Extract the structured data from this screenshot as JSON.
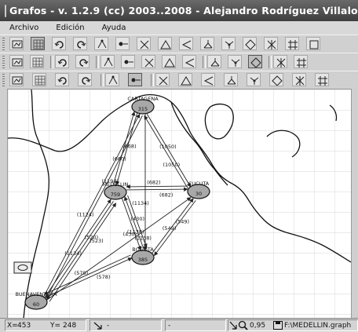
{
  "window": {
    "title": "Grafos - v. 1.2.9  (cc) 2003..2008 - Alejandro Rodríguez Villalobos"
  },
  "menu": [
    "Archivo",
    "Edición",
    "Ayuda"
  ],
  "toolbars": {
    "row1": [
      "new-graph-icon",
      "grid-icon",
      "undo-icon",
      "redo-icon",
      "bend-icon",
      "draw-node-icon",
      "edit-node-icon",
      "triangle-icon",
      "arrow-icon",
      "tree-icon",
      "tree-alt-icon",
      "network-icon",
      "network-alt-icon",
      "network-flow-icon",
      "frame-icon"
    ],
    "row2": [
      "open-icon",
      "save-icon",
      "matrix-icon",
      "matrix-alt-icon",
      "table-icon",
      "table-alt-icon",
      "table-grid-icon",
      "list-icon",
      "list-alt-icon",
      "connect-icon",
      "connect-alt-icon",
      "connect-active-icon",
      "path-icon",
      "path-alt-icon"
    ],
    "row3": [
      "shape-tool-icon",
      "tree-tool-icon",
      "route-tool-icon",
      "gear-tool-icon",
      "select-icon",
      "move-icon",
      "edge-tool-icon",
      "arc-tool-icon",
      "loop-tool-icon",
      "polygon-tool-icon",
      "curve-tool-icon",
      "hexagon-tool-icon",
      "cube-tool-icon",
      "pattern-tool-icon"
    ]
  },
  "graph": {
    "nodes": [
      {
        "id": "cartagena",
        "label": "CARTAGENA",
        "value": "315"
      },
      {
        "id": "medellin",
        "label": "MEDELLIN",
        "value": "759"
      },
      {
        "id": "cucuta",
        "label": "CUCUTA",
        "value": "30"
      },
      {
        "id": "bogota",
        "label": "BOGOTA",
        "value": "385"
      },
      {
        "id": "buenaventura",
        "label": "BUENAVENTURA",
        "value": "60"
      }
    ],
    "edges": [
      {
        "from": "cartagena",
        "to": "medellin",
        "label": "(660)"
      },
      {
        "from": "medellin",
        "to": "cartagena",
        "label": "(668)"
      },
      {
        "from": "cartagena",
        "to": "cucuta",
        "label": "(1050)"
      },
      {
        "from": "cucuta",
        "to": "cartagena",
        "label": "(1050)"
      },
      {
        "from": "cartagena",
        "to": "bogota",
        "label": "(1134)"
      },
      {
        "from": "medellin",
        "to": "cucuta",
        "label": "(682)"
      },
      {
        "from": "cucuta",
        "to": "medellin",
        "label": "(682)"
      },
      {
        "from": "medellin",
        "to": "bogota",
        "label": "(430)"
      },
      {
        "from": "bogota",
        "to": "medellin",
        "label": "(430)"
      },
      {
        "from": "bogota",
        "to": "cucuta",
        "label": "(549)"
      },
      {
        "from": "cucuta",
        "to": "bogota",
        "label": "(549)"
      },
      {
        "from": "buenaventura",
        "to": "medellin",
        "label": "(520)"
      },
      {
        "from": "medellin",
        "to": "buenaventura",
        "label": "(1134)"
      },
      {
        "from": "buenaventura",
        "to": "bogota",
        "label": "(578)"
      },
      {
        "from": "bogota",
        "to": "buenaventura",
        "label": "(578)"
      },
      {
        "from": "buenaventura",
        "to": "cartagena",
        "label": "(1194)"
      },
      {
        "from": "buenaventura",
        "to": "cucuta",
        "label": "(1138)"
      },
      {
        "from": "cartagena",
        "to": "buenaventura",
        "label": "(1124)"
      },
      {
        "from": "medellin",
        "to": "bogota",
        "label": "(1138)"
      },
      {
        "from": "buenaventura",
        "to": "medellin",
        "label": "(523)"
      }
    ]
  },
  "status": {
    "x_label": "X=",
    "x": "453",
    "y_label": "Y=",
    "y": "248",
    "arrow_mode": "-",
    "field2": "-",
    "zoom": "0,95",
    "file": "F:\\MEDELLIN.graph"
  }
}
